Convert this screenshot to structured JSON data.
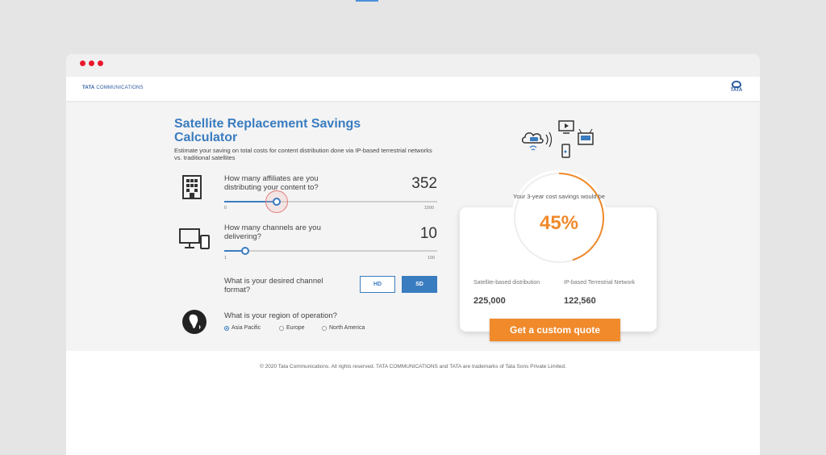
{
  "header": {
    "brand_bold": "TATA",
    "brand_rest": " COMMUNICATIONS",
    "logo_word": "TATA"
  },
  "calculator": {
    "title": "Satellite Replacement Savings Calculator",
    "description": "Estimate your saving on total costs for content distribution done via IP-based terrestrial networks vs. traditional satellites"
  },
  "affiliates": {
    "question": "How many affiliates are you distributing your content to?",
    "value": "352",
    "min": "0",
    "max": "1500",
    "fill_fraction": 0.247
  },
  "channels": {
    "question": "How many channels are you delivering?",
    "value": "10",
    "min": "1",
    "max": "100",
    "fill_fraction": 0.1
  },
  "format": {
    "question": "What is your desired channel format?",
    "options": [
      "HD",
      "SD"
    ],
    "selected": "SD"
  },
  "region": {
    "question": "What is your region of operation?",
    "options": [
      "Asia Pacific",
      "Europe",
      "North America"
    ],
    "selected": "Asia Pacific"
  },
  "result": {
    "savings_text": "Your 3-year cost savings would be",
    "savings_pct": "45%",
    "savings_fraction": 0.45,
    "satellite_label": "Satellite-based distribution",
    "satellite_value": "225,000",
    "ip_label": "IP-based Terrestrial Network",
    "ip_value": "122,560",
    "cta_label": "Get a custom quote"
  },
  "colors": {
    "accent_blue": "#3a7cc0",
    "accent_orange": "#f08a2b",
    "window_dot": "#e8192c"
  },
  "footer": {
    "copyright": "© 2020 Tata Communications. All rights reserved. TATA COMMUNICATIONS and TATA are trademarks of Tata Sons Private Limited."
  }
}
